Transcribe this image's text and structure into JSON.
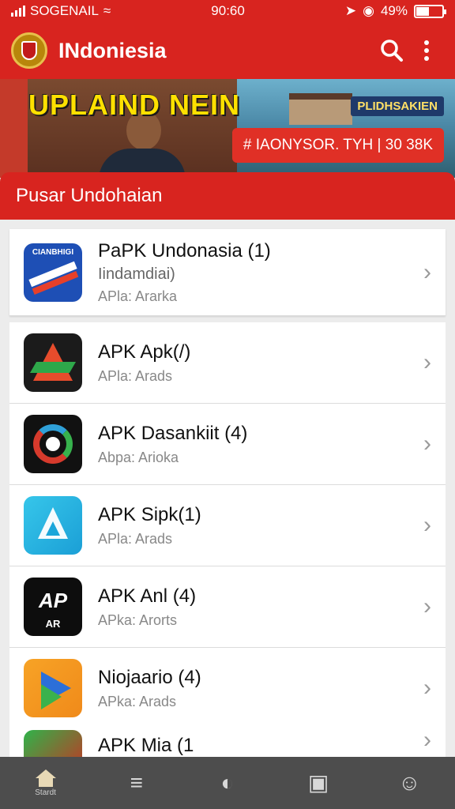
{
  "status_bar": {
    "carrier": "SOGENAIL",
    "time": "90:60",
    "battery_text": "49%",
    "battery_level": 0.49
  },
  "app_bar": {
    "title": "INdoniesia",
    "logo_icon": "garuda-emblem-icon",
    "search_icon": "search-icon",
    "menu_icon": "more-vert-icon"
  },
  "banner": {
    "headline": "UPLAIND NEIN",
    "tag": "PLIDHSAKIEN",
    "cta": "# IAONYSOR. TYH | 30 38K"
  },
  "section": {
    "title": "Pusar Undohaian"
  },
  "apps": [
    {
      "name": "PaPK Undonasia (1)",
      "subtitle": "Iindamdiai)",
      "meta": "APla: Ararka",
      "icon_text": "CIANBHIGI"
    },
    {
      "name": "APK Apk(/)",
      "subtitle": "",
      "meta": "APla: Arads"
    },
    {
      "name": "APK Dasankiit (4)",
      "subtitle": "",
      "meta": "Abpa: Arioka"
    },
    {
      "name": "APK Sipk(1)",
      "subtitle": "",
      "meta": "APla: Arads"
    },
    {
      "name": "APK Anl (4)",
      "subtitle": "",
      "meta": "APka: Arorts",
      "icon_text_top": "AP",
      "icon_text_bottom": "AR"
    },
    {
      "name": "Niojaario (4)",
      "subtitle": "",
      "meta": "APka: Arads"
    },
    {
      "name": "APK Mia (1",
      "subtitle": "",
      "meta": ""
    }
  ],
  "bottom_nav": [
    {
      "icon": "home-icon",
      "label": "Stardt",
      "active": true
    },
    {
      "icon": "list-icon",
      "label": "",
      "active": false
    },
    {
      "icon": "timer-icon",
      "label": "",
      "active": false
    },
    {
      "icon": "window-icon",
      "label": "",
      "active": false
    },
    {
      "icon": "profile-icon",
      "label": "",
      "active": false
    }
  ],
  "colors": {
    "primary": "#d8241f",
    "nav_bg": "#4d4d4d",
    "banner_text": "#ffe000"
  }
}
